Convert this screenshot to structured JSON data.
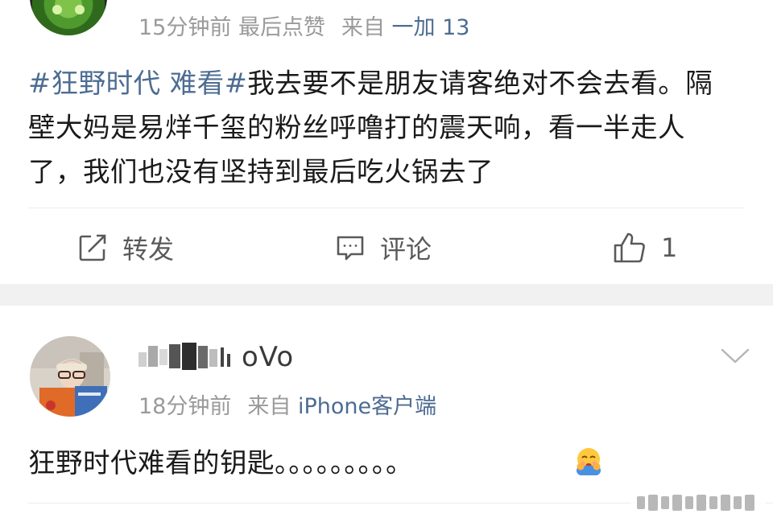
{
  "post": {
    "meta": {
      "time": "15分钟前",
      "last_like": "最后点赞",
      "from_label": "来自",
      "source": "一加 13"
    },
    "hashtag": "#狂野时代 难看#",
    "body": "我去要不是朋友请客绝对不会去看。隔壁大妈是易烊千玺的粉丝呼噜打的震天响，看一半走人了，我们也没有坚持到最后吃火锅去了",
    "actions": {
      "repost_label": "转发",
      "comment_label": "评论",
      "like_count": "1"
    }
  },
  "comment": {
    "username": "oVo",
    "meta": {
      "time": "18分钟前",
      "from_label": "来自",
      "source": "iPhone客户端"
    },
    "text": "狂野时代难看的钥匙。。。。。。。。。"
  },
  "colors": {
    "link": "#4d6c92",
    "meta_gray": "#9a9a9a",
    "icon_gray": "#5a5a5a",
    "band": "#f1f1f1"
  }
}
